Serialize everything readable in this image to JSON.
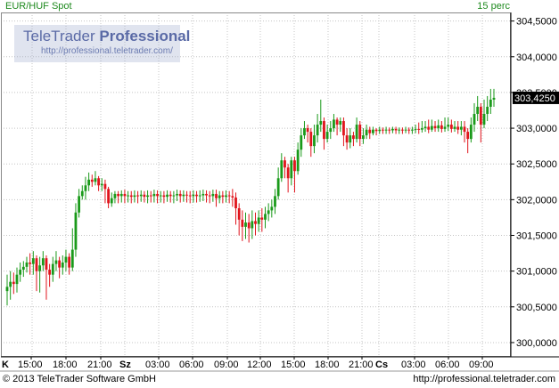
{
  "header": {
    "instrument": "EUR/HUF Spot",
    "interval": "15 perc"
  },
  "watermark": {
    "brand_regular": "TeleTrader",
    "brand_bold": "Professional",
    "url": "http://professional.teletrader.com/"
  },
  "footer": {
    "copyright": "© 2013 TeleTrader Software GmbH",
    "url": "http://professional.teletrader.com"
  },
  "colors": {
    "up": "#1a9a1a",
    "down": "#e0141c",
    "grid": "#c4c4c4",
    "frame": "#000000",
    "header_text": "#1f8a1f",
    "last_price_label_bg": "#000000"
  },
  "chart_data": {
    "type": "candlestick",
    "title": "EUR/HUF Spot",
    "interval": "15 perc",
    "ylim": [
      299.8,
      304.62
    ],
    "y_ticks": [
      "304,5000",
      "304,0000",
      "303,5000",
      "303,0000",
      "302,5000",
      "302,0000",
      "301,5000",
      "301,0000",
      "300,5000",
      "300,0000"
    ],
    "y_tick_values": [
      304.5,
      304.0,
      303.5,
      303.0,
      302.5,
      302.0,
      301.5,
      301.0,
      300.5,
      300.0
    ],
    "last_price": "303,4250",
    "last_price_value": 303.425,
    "grid": true,
    "x_day_markers": [
      {
        "label": "K",
        "slot": 0
      },
      {
        "label": "Sz",
        "slot": 8
      },
      {
        "label": "Cs",
        "slot": 16
      }
    ],
    "x_time_ticks": [
      {
        "label": "15:00",
        "slot": 1
      },
      {
        "label": "18:00",
        "slot": 2
      },
      {
        "label": "21:00",
        "slot": 3
      },
      {
        "label": "03:00",
        "slot": 4
      },
      {
        "label": "06:00",
        "slot": 5
      },
      {
        "label": "09:00",
        "slot": 6
      },
      {
        "label": "12:00",
        "slot": 7
      },
      {
        "label": "15:00",
        "slot": 9
      },
      {
        "label": "18:00",
        "slot": 10
      },
      {
        "label": "21:00",
        "slot": 11
      },
      {
        "label": "03:00",
        "slot": 12
      },
      {
        "label": "06:00",
        "slot": 13
      },
      {
        "label": "09:00",
        "slot": 14
      }
    ],
    "price_path": [
      [
        0,
        300.75
      ],
      [
        3,
        300.88
      ],
      [
        6,
        301.05
      ],
      [
        9,
        301.1
      ],
      [
        12,
        301.2
      ],
      [
        15,
        301.0
      ],
      [
        18,
        301.18
      ],
      [
        21,
        300.95
      ],
      [
        24,
        301.15
      ],
      [
        27,
        301.0
      ],
      [
        29,
        301.85
      ],
      [
        31,
        302.15
      ],
      [
        34,
        302.3
      ],
      [
        37,
        302.22
      ],
      [
        40,
        302.2
      ],
      [
        43,
        301.95
      ],
      [
        46,
        302.08
      ],
      [
        50,
        302.05
      ],
      [
        55,
        302.05
      ],
      [
        60,
        302.05
      ],
      [
        65,
        302.08
      ],
      [
        70,
        302.05
      ],
      [
        73,
        301.75
      ],
      [
        75,
        301.6
      ],
      [
        78,
        301.7
      ],
      [
        80,
        301.85
      ],
      [
        82,
        301.9
      ],
      [
        84,
        302.05
      ],
      [
        86,
        302.5
      ],
      [
        88,
        302.3
      ],
      [
        90,
        302.65
      ],
      [
        92,
        302.85
      ],
      [
        94,
        302.95
      ],
      [
        96,
        302.7
      ],
      [
        97,
        302.95
      ],
      [
        99,
        303.1
      ],
      [
        101,
        302.9
      ],
      [
        104,
        302.85
      ],
      [
        106,
        303.05
      ],
      [
        108,
        302.95
      ],
      [
        111,
        303.0
      ],
      [
        114,
        303.0
      ],
      [
        118,
        302.98
      ],
      [
        122,
        302.98
      ],
      [
        126,
        302.98
      ],
      [
        130,
        302.98
      ],
      [
        134,
        303.0
      ],
      [
        138,
        303.05
      ],
      [
        142,
        303.0
      ],
      [
        146,
        303.05
      ],
      [
        150,
        302.98
      ],
      [
        153,
        302.95
      ],
      [
        156,
        303.1
      ],
      [
        159,
        303.3
      ],
      [
        162,
        303.05
      ],
      [
        165,
        303.25
      ],
      [
        168,
        303.42
      ]
    ],
    "candles": [
      [
        300.72,
        300.78,
        300.52,
        300.95
      ],
      [
        300.78,
        300.85,
        300.6,
        301.0
      ],
      [
        300.85,
        300.82,
        300.68,
        300.98
      ],
      [
        300.82,
        300.95,
        300.7,
        301.05
      ],
      [
        300.95,
        301.02,
        300.85,
        301.12
      ],
      [
        301.02,
        301.06,
        300.92,
        301.14
      ],
      [
        301.06,
        301.12,
        300.98,
        301.2
      ],
      [
        301.12,
        301.1,
        300.95,
        301.25
      ],
      [
        301.1,
        301.18,
        300.95,
        301.28
      ],
      [
        301.18,
        301.0,
        300.72,
        301.22
      ],
      [
        301.0,
        301.08,
        300.7,
        301.2
      ],
      [
        301.08,
        301.18,
        301.0,
        301.28
      ],
      [
        301.18,
        301.02,
        300.6,
        301.22
      ],
      [
        301.02,
        300.95,
        300.78,
        301.1
      ],
      [
        300.95,
        301.1,
        300.85,
        301.2
      ],
      [
        301.1,
        301.15,
        301.0,
        301.28
      ],
      [
        301.15,
        301.05,
        300.9,
        301.2
      ],
      [
        301.05,
        301.12,
        300.95,
        301.22
      ],
      [
        301.12,
        301.2,
        301.0,
        301.3
      ],
      [
        301.2,
        301.05,
        300.95,
        301.25
      ],
      [
        301.05,
        301.3,
        301.0,
        301.6
      ],
      [
        301.3,
        301.82,
        301.2,
        301.95
      ],
      [
        301.82,
        302.05,
        301.75,
        302.15
      ],
      [
        302.05,
        302.12,
        302.0,
        302.2
      ],
      [
        302.12,
        302.2,
        302.0,
        302.32
      ],
      [
        302.2,
        302.28,
        302.12,
        302.38
      ],
      [
        302.28,
        302.25,
        302.18,
        302.35
      ],
      [
        302.25,
        302.3,
        302.2,
        302.4
      ],
      [
        302.3,
        302.2,
        302.12,
        302.33
      ],
      [
        302.2,
        302.22,
        302.12,
        302.3
      ],
      [
        302.22,
        302.15,
        301.95,
        302.28
      ],
      [
        302.15,
        301.95,
        301.88,
        302.18
      ],
      [
        301.95,
        302.02,
        301.9,
        302.1
      ],
      [
        302.02,
        302.08,
        301.95,
        302.12
      ],
      [
        302.08,
        302.05,
        301.95,
        302.12
      ],
      [
        302.05,
        302.08,
        301.96,
        302.13
      ],
      [
        302.08,
        302.05,
        301.95,
        302.14
      ],
      [
        302.05,
        302.06,
        301.96,
        302.12
      ],
      [
        302.06,
        302.04,
        301.95,
        302.12
      ],
      [
        302.04,
        302.06,
        301.96,
        302.13
      ],
      [
        302.06,
        302.05,
        301.95,
        302.12
      ],
      [
        302.05,
        302.07,
        301.97,
        302.13
      ],
      [
        302.07,
        302.04,
        301.96,
        302.12
      ],
      [
        302.04,
        302.06,
        301.95,
        302.13
      ],
      [
        302.06,
        302.05,
        301.96,
        302.12
      ],
      [
        302.05,
        302.08,
        301.96,
        302.14
      ],
      [
        302.08,
        302.05,
        301.95,
        302.13
      ],
      [
        302.05,
        302.06,
        301.96,
        302.12
      ],
      [
        302.06,
        302.04,
        301.95,
        302.12
      ],
      [
        302.04,
        302.07,
        301.97,
        302.13
      ],
      [
        302.07,
        302.05,
        301.96,
        302.12
      ],
      [
        302.05,
        302.06,
        301.95,
        302.12
      ],
      [
        302.06,
        302.08,
        301.98,
        302.14
      ],
      [
        302.08,
        302.05,
        301.96,
        302.13
      ],
      [
        302.05,
        302.07,
        301.97,
        302.13
      ],
      [
        302.07,
        302.06,
        301.96,
        302.12
      ],
      [
        302.06,
        302.05,
        301.95,
        302.12
      ],
      [
        302.05,
        302.07,
        301.96,
        302.13
      ],
      [
        302.07,
        302.05,
        301.96,
        302.12
      ],
      [
        302.05,
        302.06,
        301.97,
        302.13
      ],
      [
        302.06,
        302.08,
        301.98,
        302.14
      ],
      [
        302.08,
        302.06,
        301.96,
        302.13
      ],
      [
        302.06,
        302.05,
        301.95,
        302.12
      ],
      [
        302.05,
        302.08,
        301.97,
        302.14
      ],
      [
        302.08,
        302.02,
        301.9,
        302.14
      ],
      [
        302.02,
        302.06,
        301.95,
        302.12
      ],
      [
        302.06,
        302.04,
        301.95,
        302.12
      ],
      [
        302.04,
        302.06,
        301.96,
        302.13
      ],
      [
        302.06,
        302.05,
        301.95,
        302.12
      ],
      [
        302.05,
        302.03,
        301.9,
        302.15
      ],
      [
        302.03,
        301.88,
        301.65,
        302.1
      ],
      [
        301.88,
        301.72,
        301.5,
        301.95
      ],
      [
        301.72,
        301.62,
        301.42,
        301.85
      ],
      [
        301.62,
        301.68,
        301.45,
        301.82
      ],
      [
        301.68,
        301.6,
        301.4,
        301.8
      ],
      [
        301.6,
        301.7,
        301.45,
        301.85
      ],
      [
        301.7,
        301.66,
        301.5,
        301.82
      ],
      [
        301.66,
        301.75,
        301.55,
        301.85
      ],
      [
        301.75,
        301.72,
        301.55,
        301.88
      ],
      [
        301.72,
        301.8,
        301.6,
        301.9
      ],
      [
        301.8,
        301.85,
        301.7,
        301.95
      ],
      [
        301.85,
        301.9,
        301.75,
        302.0
      ],
      [
        301.9,
        302.05,
        301.8,
        302.15
      ],
      [
        302.05,
        302.3,
        302.0,
        302.45
      ],
      [
        302.3,
        302.55,
        302.25,
        302.65
      ],
      [
        302.55,
        302.45,
        302.3,
        302.6
      ],
      [
        302.45,
        302.3,
        302.1,
        302.5
      ],
      [
        302.3,
        302.55,
        302.2,
        302.6
      ],
      [
        302.55,
        302.4,
        302.1,
        302.6
      ],
      [
        302.4,
        302.7,
        302.35,
        302.8
      ],
      [
        302.7,
        302.9,
        302.6,
        303.0
      ],
      [
        302.9,
        303.0,
        302.85,
        303.1
      ],
      [
        303.0,
        302.95,
        302.8,
        303.05
      ],
      [
        302.95,
        302.75,
        302.6,
        303.0
      ],
      [
        302.75,
        302.9,
        302.65,
        303.05
      ],
      [
        302.9,
        303.05,
        302.8,
        303.2
      ],
      [
        303.05,
        303.1,
        302.95,
        303.4
      ],
      [
        303.1,
        302.85,
        302.7,
        303.15
      ],
      [
        302.85,
        302.95,
        302.8,
        303.05
      ],
      [
        302.95,
        303.0,
        302.85,
        303.1
      ],
      [
        303.0,
        303.12,
        302.95,
        303.2
      ],
      [
        303.12,
        303.05,
        302.9,
        303.15
      ],
      [
        303.05,
        303.1,
        302.95,
        303.15
      ],
      [
        303.1,
        302.9,
        302.75,
        303.15
      ],
      [
        302.9,
        302.8,
        302.7,
        303.0
      ],
      [
        302.8,
        302.9,
        302.72,
        303.0
      ],
      [
        302.9,
        302.85,
        302.75,
        302.95
      ],
      [
        302.85,
        303.05,
        302.8,
        303.15
      ],
      [
        303.05,
        302.85,
        302.75,
        303.1
      ],
      [
        302.85,
        302.9,
        302.78,
        303.0
      ],
      [
        302.9,
        302.98,
        302.85,
        303.05
      ],
      [
        302.98,
        302.93,
        302.85,
        303.02
      ],
      [
        302.93,
        302.98,
        302.9,
        303.02
      ],
      [
        302.98,
        302.96,
        302.9,
        303.0
      ],
      [
        302.96,
        302.98,
        302.92,
        303.02
      ],
      [
        302.98,
        302.97,
        302.92,
        303.01
      ],
      [
        302.97,
        302.98,
        302.92,
        303.02
      ],
      [
        302.98,
        302.97,
        302.92,
        303.01
      ],
      [
        302.97,
        302.99,
        302.93,
        303.02
      ],
      [
        302.99,
        302.97,
        302.92,
        303.02
      ],
      [
        302.97,
        302.98,
        302.92,
        303.01
      ],
      [
        302.98,
        302.97,
        302.92,
        303.01
      ],
      [
        302.97,
        302.98,
        302.93,
        303.02
      ],
      [
        302.98,
        302.97,
        302.92,
        303.01
      ],
      [
        302.97,
        302.98,
        302.92,
        303.02
      ],
      [
        302.98,
        302.99,
        302.93,
        303.05
      ],
      [
        302.99,
        302.98,
        302.92,
        303.08
      ],
      [
        302.98,
        303.0,
        302.94,
        303.1
      ],
      [
        303.0,
        303.02,
        302.95,
        303.1
      ],
      [
        303.02,
        302.98,
        302.93,
        303.12
      ],
      [
        302.98,
        303.03,
        302.95,
        303.12
      ],
      [
        303.03,
        303.0,
        302.95,
        303.1
      ],
      [
        303.0,
        303.04,
        302.95,
        303.12
      ],
      [
        303.04,
        302.99,
        302.94,
        303.1
      ],
      [
        302.99,
        303.02,
        302.95,
        303.15
      ],
      [
        303.02,
        303.05,
        302.96,
        303.15
      ],
      [
        303.05,
        302.99,
        302.94,
        303.12
      ],
      [
        302.99,
        303.02,
        302.95,
        303.1
      ],
      [
        303.02,
        302.98,
        302.92,
        303.1
      ],
      [
        302.98,
        303.02,
        302.9,
        303.1
      ],
      [
        303.02,
        302.95,
        302.8,
        303.1
      ],
      [
        302.95,
        302.85,
        302.65,
        303.0
      ],
      [
        302.85,
        303.05,
        302.8,
        303.15
      ],
      [
        303.05,
        303.2,
        302.95,
        303.35
      ],
      [
        303.2,
        303.3,
        303.1,
        303.45
      ],
      [
        303.3,
        303.05,
        302.8,
        303.35
      ],
      [
        303.05,
        303.2,
        303.0,
        303.4
      ],
      [
        303.2,
        303.3,
        303.1,
        303.45
      ],
      [
        303.3,
        303.4,
        303.2,
        303.55
      ],
      [
        303.4,
        303.425,
        303.3,
        303.55
      ]
    ]
  }
}
